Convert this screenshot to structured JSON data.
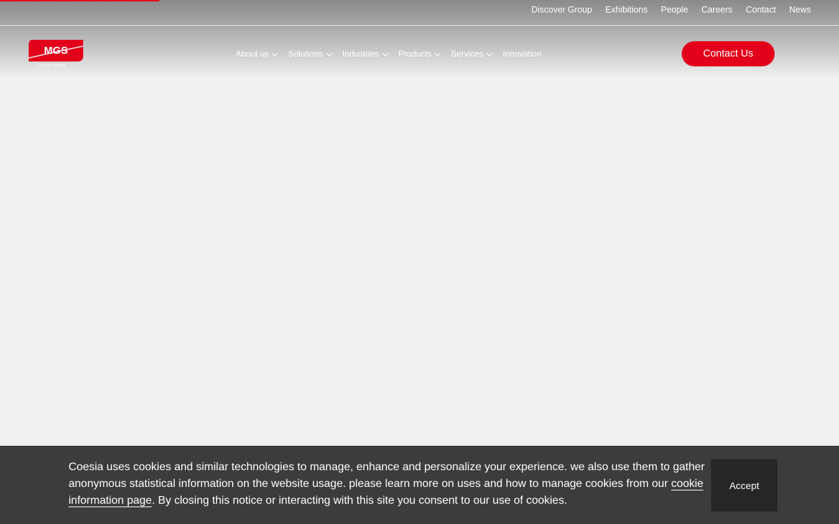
{
  "top_nav": [
    "Discover Group",
    "Exhibitions",
    "People",
    "Careers",
    "Contact",
    "News"
  ],
  "logo": {
    "text": "MGS",
    "tagline": "a coesia company",
    "color": "#e3001b"
  },
  "main_nav": [
    {
      "label": "About us",
      "has_dropdown": true,
      "icon": "chevron-down-icon"
    },
    {
      "label": "Solutions",
      "has_dropdown": true,
      "icon": "chevron-down-icon"
    },
    {
      "label": "Industries",
      "has_dropdown": true,
      "icon": "chevron-down-icon"
    },
    {
      "label": "Products",
      "has_dropdown": true,
      "icon": "chevron-down-icon"
    },
    {
      "label": "Services",
      "has_dropdown": true,
      "icon": "chevron-down-icon"
    },
    {
      "label": "Innovation",
      "has_dropdown": false
    }
  ],
  "contact_button": {
    "label": "Contact Us",
    "color": "#e3001b"
  },
  "cookie_banner": {
    "text_before_link": "Coesia uses cookies and similar technologies to manage, enhance and personalize your experience. we also use them to gather anonymous statistical information on the website usage. please learn more on uses and how to manage cookies from our ",
    "link_text": "cookie information page",
    "text_after_link": ". By closing this notice or interacting with this site you consent to our use of cookies.",
    "accept_label": "Accept"
  },
  "colors": {
    "accent": "#e3001b",
    "banner_bg": "#3c3c3c",
    "accept_bg": "#262626",
    "page_bg": "#f0f0f0"
  }
}
